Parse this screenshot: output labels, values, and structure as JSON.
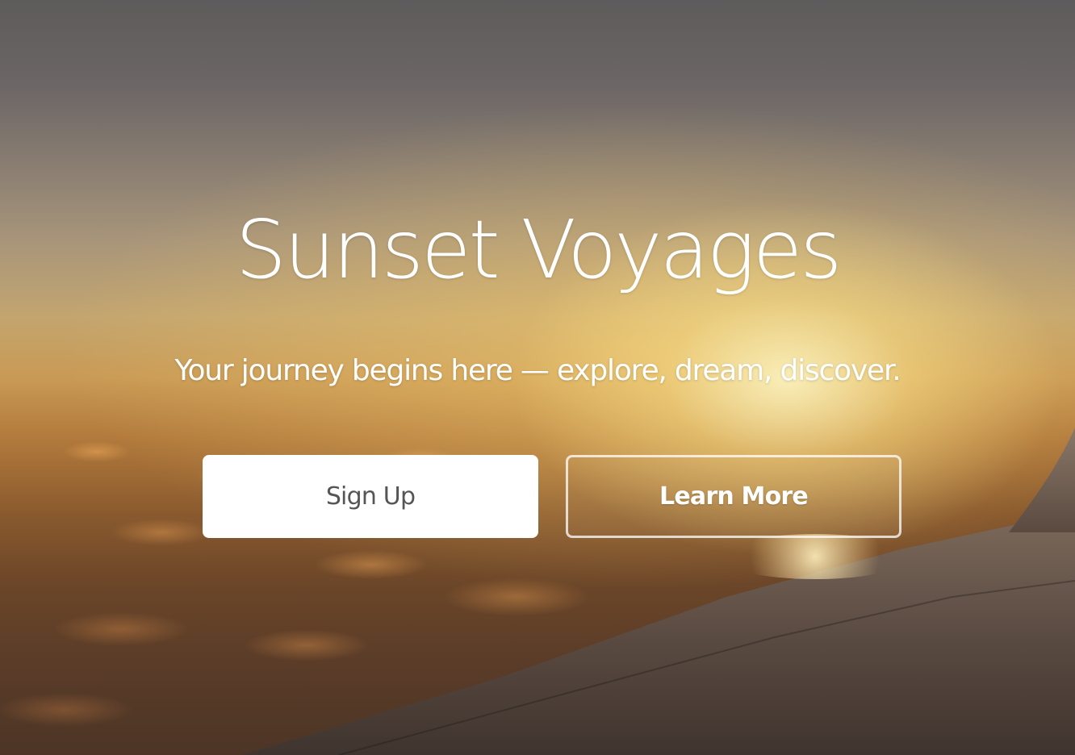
{
  "hero": {
    "title": "Sunset Voyages",
    "subtitle": "Your journey begins here — explore, dream, discover.",
    "background_image": "sunset-over-clouds-airplane-wing",
    "buttons": {
      "primary_label": "Sign Up",
      "secondary_label": "Learn More"
    }
  },
  "colors": {
    "primary_button_bg": "#ffffff",
    "primary_button_text": "#555555",
    "text": "#ffffff"
  }
}
